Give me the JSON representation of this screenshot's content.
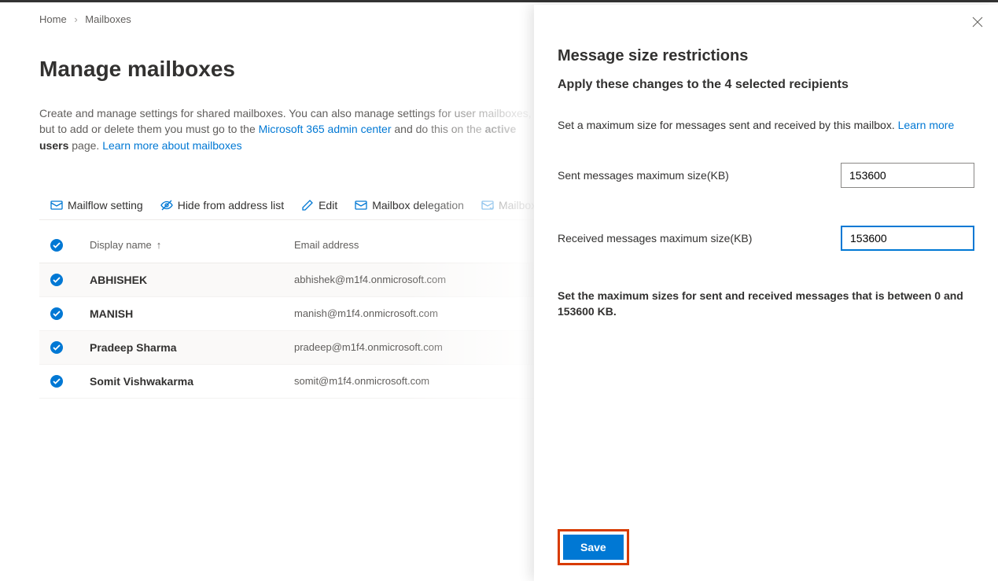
{
  "breadcrumb": {
    "home": "Home",
    "current": "Mailboxes"
  },
  "page": {
    "title": "Manage mailboxes",
    "desc_part1": "Create and manage settings for shared mailboxes. You can also manage settings for user mailboxes, but to add or delete them you must go to the ",
    "desc_link1": "Microsoft 365 admin center",
    "desc_part2": " and do this on the ",
    "desc_bold": "active users",
    "desc_part3": " page. ",
    "desc_link2": "Learn more about mailboxes"
  },
  "toolbar": {
    "mailflow": "Mailflow setting",
    "hide": "Hide from address list",
    "edit": "Edit",
    "delegation": "Mailbox delegation",
    "policies": "Mailbox p"
  },
  "table": {
    "col_name": "Display name",
    "col_email": "Email address",
    "rows": [
      {
        "name": "ABHISHEK",
        "email": "abhishek@m1f4.onmicrosoft.com"
      },
      {
        "name": "MANISH",
        "email": "manish@m1f4.onmicrosoft.com"
      },
      {
        "name": "Pradeep Sharma",
        "email": "pradeep@m1f4.onmicrosoft.com"
      },
      {
        "name": "Somit Vishwakarma",
        "email": "somit@m1f4.onmicrosoft.com"
      }
    ]
  },
  "panel": {
    "title": "Message size restrictions",
    "subtitle": "Apply these changes to the 4 selected recipients",
    "desc": "Set a maximum size for messages sent and received by this mailbox. ",
    "desc_link": "Learn more",
    "sent_label": "Sent messages maximum size(KB)",
    "sent_value": "153600",
    "recv_label": "Received messages maximum size(KB)",
    "recv_value": "153600",
    "note": "Set the maximum sizes for sent and received messages that is between 0 and 153600 KB.",
    "save": "Save"
  }
}
